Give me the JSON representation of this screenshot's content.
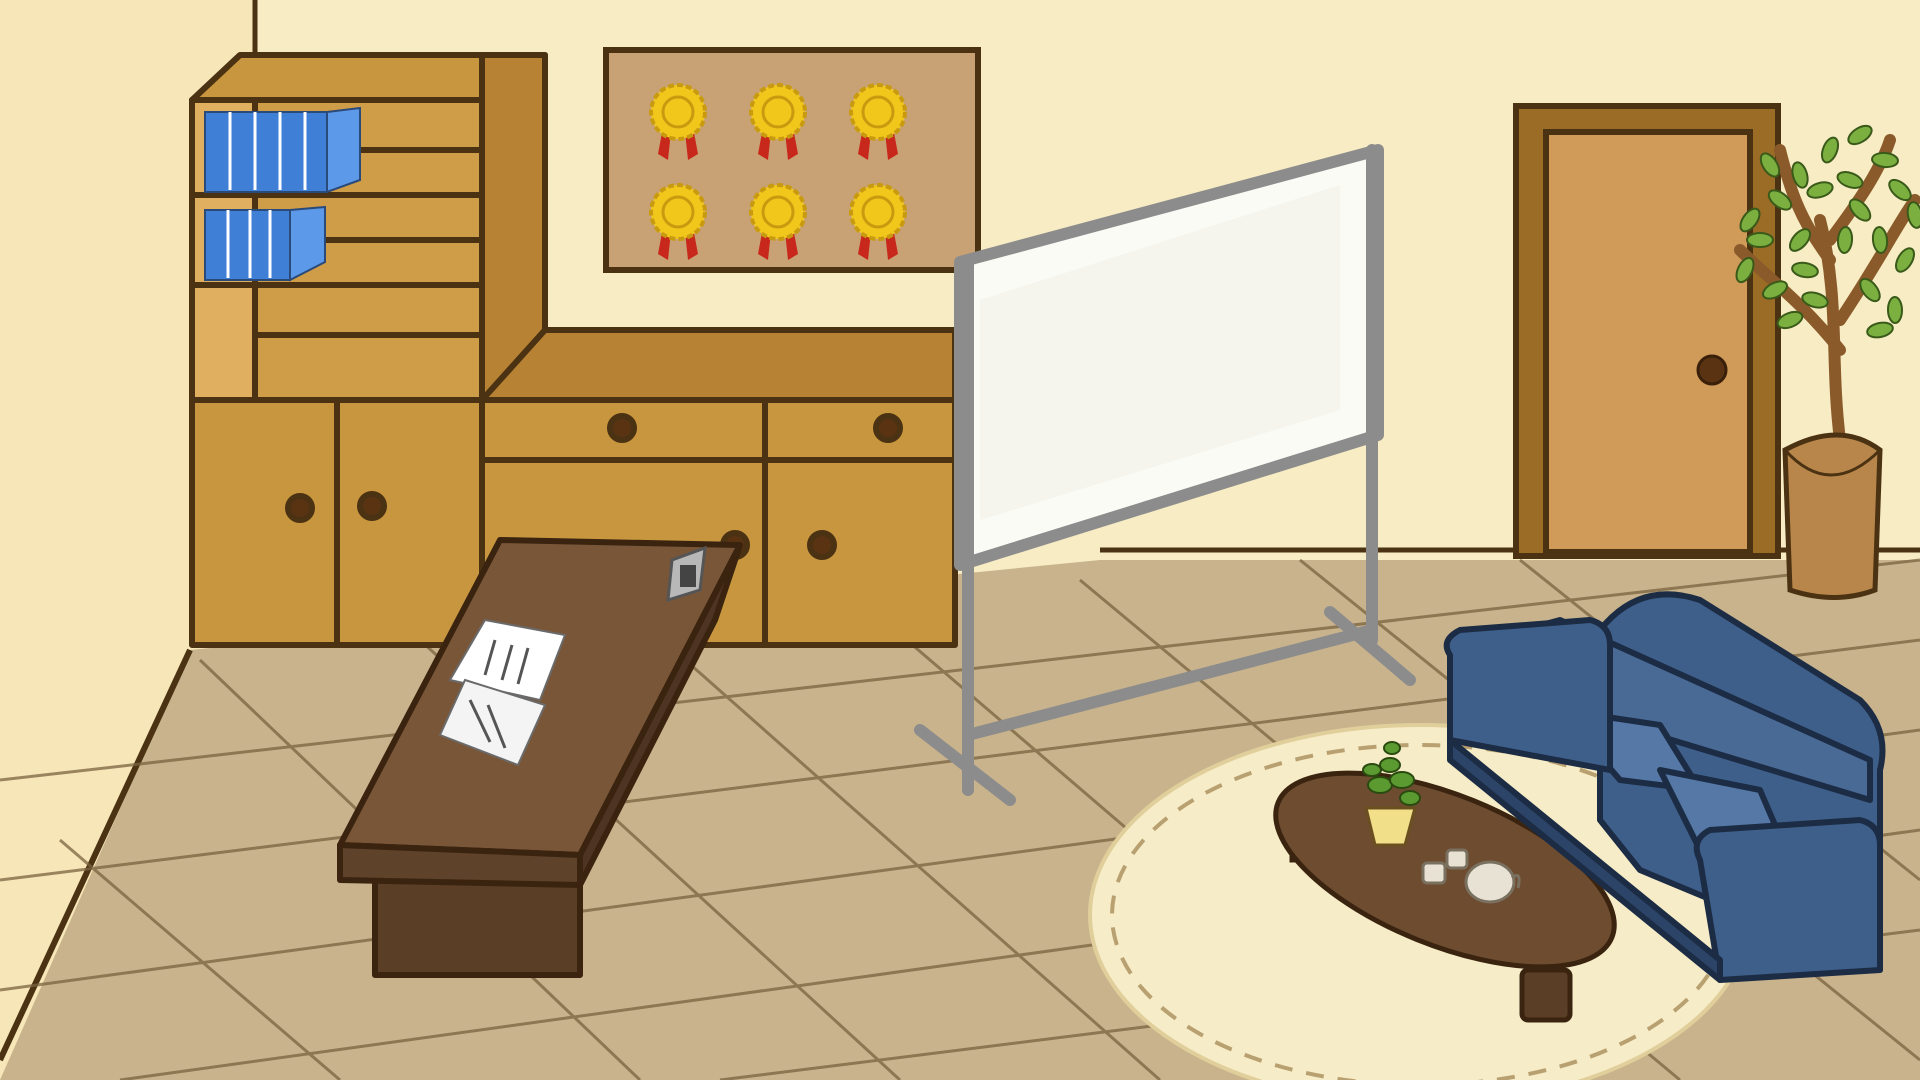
{
  "scene": {
    "title": "",
    "palette": {
      "wall": "#f8ecc4",
      "wall_shadow": "#efdca8",
      "floor": "#c8b38c",
      "floor_line": "#7a6440",
      "wood": "#c8963f",
      "wood_dark": "#9a6c26",
      "outline": "#4a3212",
      "desk": "#6e4c30",
      "desk_top": "#7a5638",
      "sofa": "#3e5f8a",
      "sofa_light": "#5578a6",
      "rug": "#f6ecc8",
      "whiteboard": "#fbfbf6",
      "frame": "#8c8c8c",
      "binder": "#3f7fd6",
      "medal_gold": "#f2c71c",
      "ribbon_red": "#c8281c",
      "plant_green": "#7bb040",
      "board_cork": "#c8a274"
    },
    "objects": [
      "bookshelf",
      "binders",
      "cabinet",
      "award-board",
      "whiteboard",
      "door",
      "potted-tree",
      "desk",
      "documents",
      "nameplate",
      "rug",
      "coffee-table",
      "small-plant",
      "teapot",
      "teacups",
      "sofa"
    ],
    "medal_count": 6
  }
}
